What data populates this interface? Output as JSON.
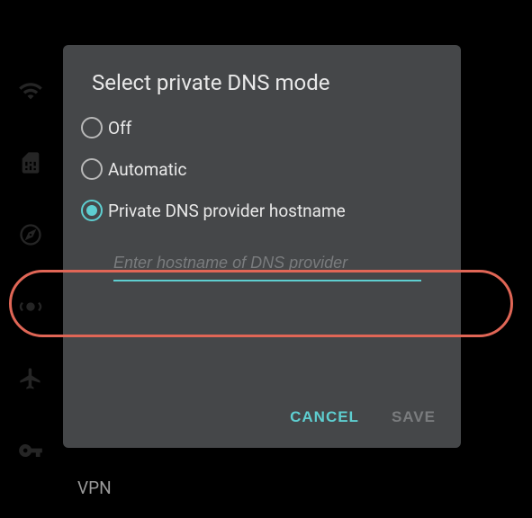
{
  "sidebar": {
    "icons": [
      "wifi",
      "sim",
      "compass",
      "broadcast",
      "airplane",
      "key"
    ]
  },
  "vpn_label": "VPN",
  "dialog": {
    "title": "Select private DNS mode",
    "options": [
      {
        "label": "Off",
        "selected": false
      },
      {
        "label": "Automatic",
        "selected": false
      },
      {
        "label": "Private DNS provider hostname",
        "selected": true
      }
    ],
    "input": {
      "placeholder": "Enter hostname of DNS provider",
      "value": ""
    },
    "actions": {
      "cancel": "CANCEL",
      "save": "SAVE"
    }
  },
  "colors": {
    "accent": "#5eced0",
    "dialog_bg": "#454749",
    "highlight": "#e06656"
  }
}
